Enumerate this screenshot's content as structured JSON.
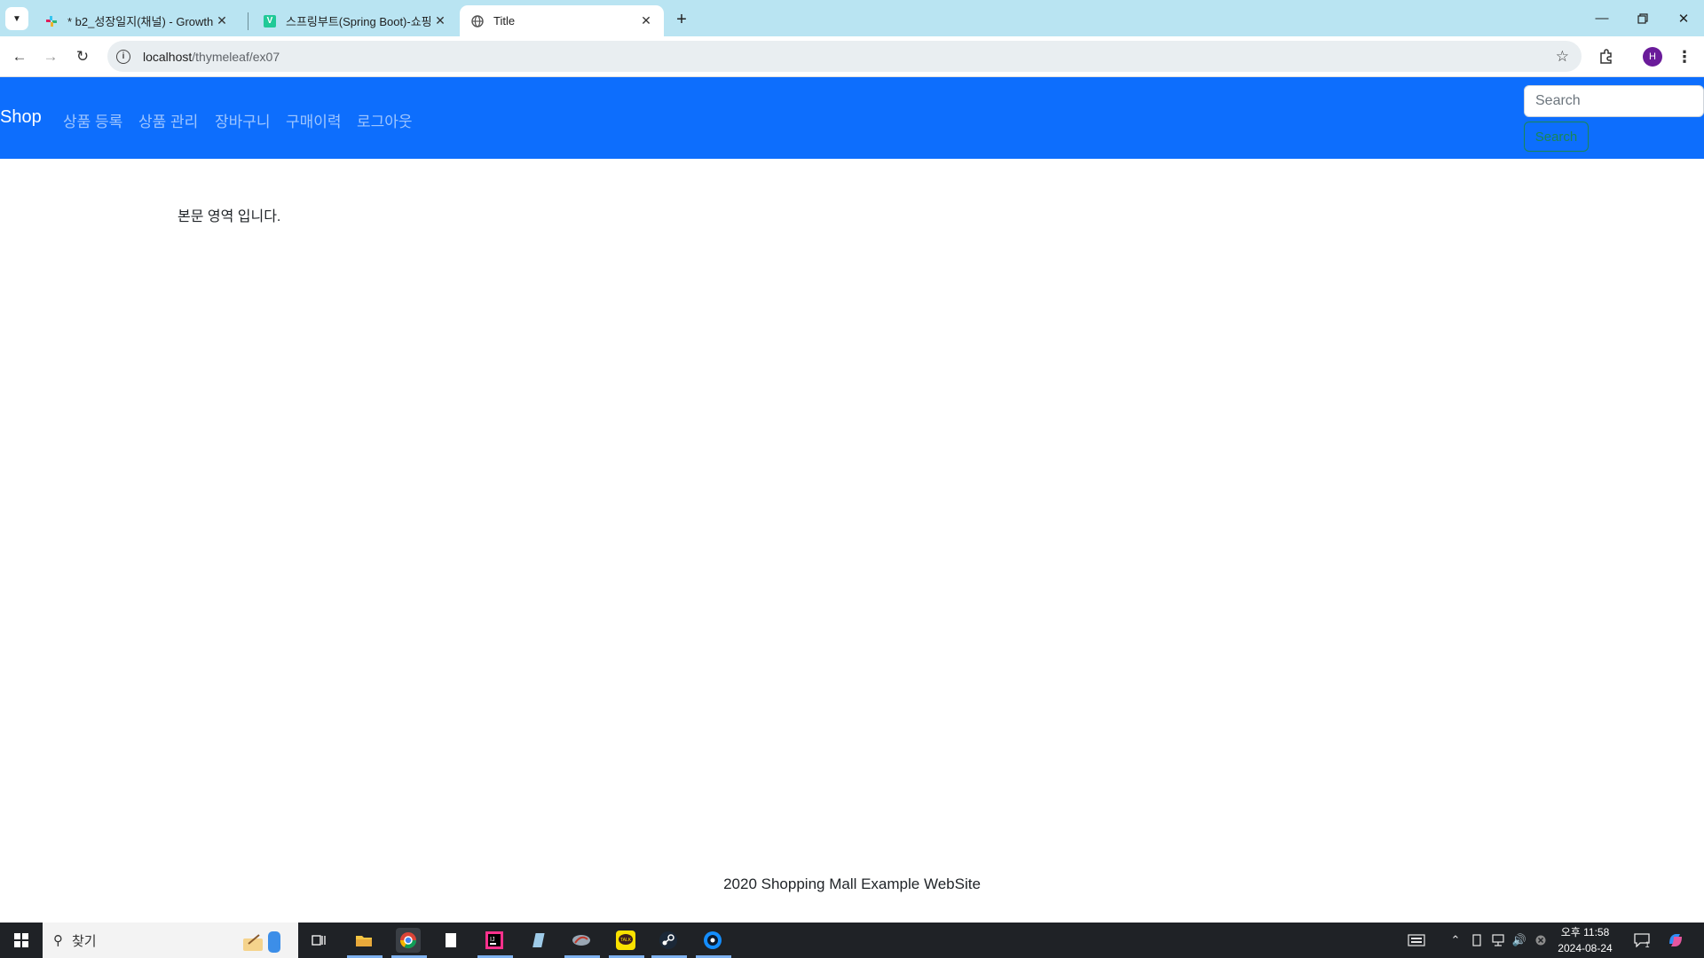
{
  "browser": {
    "tabs": [
      {
        "title": "* b2_성장일지(채널) - Growth",
        "active": false
      },
      {
        "title": "스프링부트(Spring Boot)-쇼핑",
        "active": false
      },
      {
        "title": "Title",
        "active": true
      }
    ],
    "url_host": "localhost",
    "url_path": "/thymeleaf/ex07",
    "profile_initial": "H"
  },
  "navbar": {
    "brand": "Shop",
    "links": [
      "상품 등록",
      "상품 관리",
      "장바구니",
      "구매이력",
      "로그아웃"
    ],
    "search_placeholder": "Search",
    "search_button": "Search"
  },
  "content": {
    "body_text": "본문 영역 입니다.",
    "footer_text": "2020 Shopping Mall Example WebSite"
  },
  "taskbar": {
    "search_label": "찾기",
    "clock_time": "오후 11:58",
    "clock_date": "2024-08-24",
    "notification_count": "1"
  },
  "colors": {
    "navbar_bg": "#0d6efd",
    "tabbar_bg": "#b9e4f2",
    "search_button": "#198754",
    "taskbar_bg": "#1f2226"
  }
}
